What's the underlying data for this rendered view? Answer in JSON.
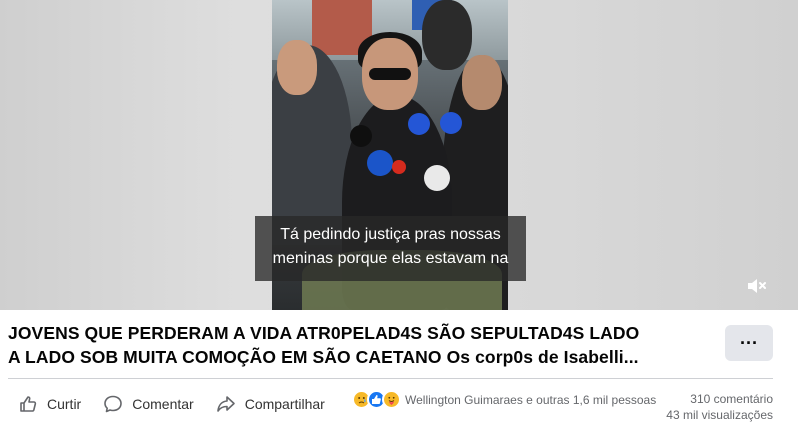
{
  "video": {
    "subtitle_line1": "Tá pedindo justiça pras nossas",
    "subtitle_line2": "meninas porque elas estavam na",
    "mute_icon": "speaker-muted-icon"
  },
  "post": {
    "title_line1": "JOVENS QUE PERDERAM A VIDA ATR0PELAD4S SÃO SEPULTAD4S LADO",
    "title_line2": "A LADO SOB MUITA COMOÇÃO EM SÃO CAETANO Os corp0s de Isabelli...",
    "more_label": "···"
  },
  "actions": {
    "like_label": "Curtir",
    "comment_label": "Comentar",
    "share_label": "Compartilhar"
  },
  "reactions": {
    "text": "Wellington Guimaraes e outras 1,6 mil pessoas",
    "comments": "310 comentário",
    "views": "43 mil visualizações"
  },
  "colors": {
    "accent": "#1877f2",
    "muted_text": "#65676b",
    "button_bg": "#e4e6eb"
  }
}
